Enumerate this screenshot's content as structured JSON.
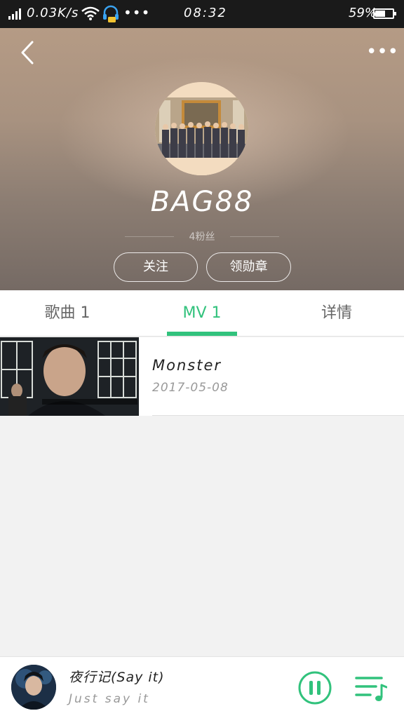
{
  "status_bar": {
    "speed": "0.03K/s",
    "time": "08:32",
    "battery": "59%",
    "battery_level": 0.59,
    "dots": "•••"
  },
  "header": {
    "artist_name": "BAG88",
    "fans_text": "4粉丝",
    "follow_label": "关注",
    "badge_label": "领勋章",
    "more_label": "•••"
  },
  "tabs": [
    {
      "label": "歌曲 1",
      "active": false
    },
    {
      "label": "MV 1",
      "active": true
    },
    {
      "label": "详情",
      "active": false
    }
  ],
  "mv_list": [
    {
      "title": "Monster",
      "date": "2017-05-08"
    }
  ],
  "player": {
    "title": "夜行记(Say it)",
    "lyric": "Just say it"
  },
  "colors": {
    "accent": "#31c27c",
    "status_bar": "#1a1a1a"
  }
}
